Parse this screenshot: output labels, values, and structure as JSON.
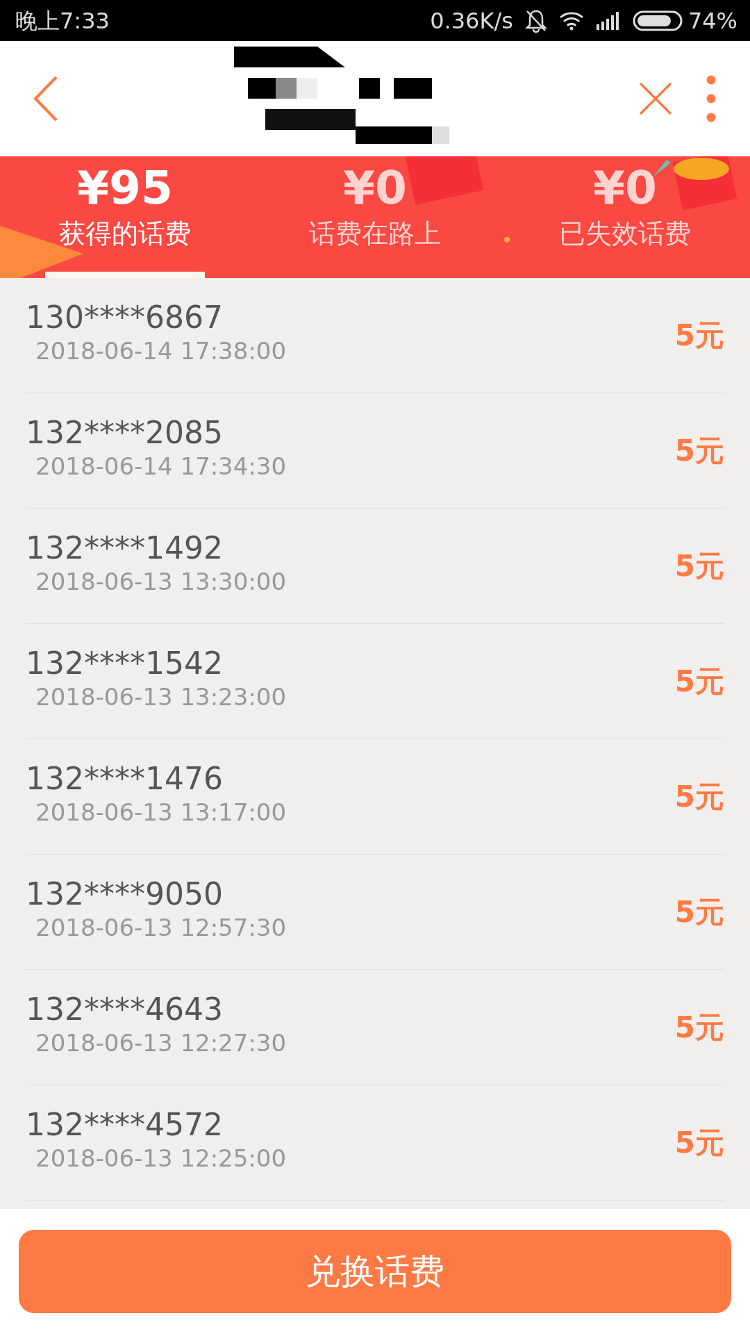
{
  "status_bar": {
    "time": "晚上7:33",
    "speed": "0.36K/s",
    "battery": "74%"
  },
  "tabs": [
    {
      "amount": "¥95",
      "label": "获得的话费",
      "selected": true
    },
    {
      "amount": "¥0",
      "label": "话费在路上",
      "selected": false
    },
    {
      "amount": "¥0",
      "label": "已失效话费",
      "selected": false
    }
  ],
  "records": [
    {
      "phone": "130****6867",
      "time": "2018-06-14 17:38:00",
      "amount": "5元"
    },
    {
      "phone": "132****2085",
      "time": "2018-06-14 17:34:30",
      "amount": "5元"
    },
    {
      "phone": "132****1492",
      "time": "2018-06-13 13:30:00",
      "amount": "5元"
    },
    {
      "phone": "132****1542",
      "time": "2018-06-13 13:23:00",
      "amount": "5元"
    },
    {
      "phone": "132****1476",
      "time": "2018-06-13 13:17:00",
      "amount": "5元"
    },
    {
      "phone": "132****9050",
      "time": "2018-06-13 12:57:30",
      "amount": "5元"
    },
    {
      "phone": "132****4643",
      "time": "2018-06-13 12:27:30",
      "amount": "5元"
    },
    {
      "phone": "132****4572",
      "time": "2018-06-13 12:25:00",
      "amount": "5元"
    }
  ],
  "button": "兑换话费"
}
